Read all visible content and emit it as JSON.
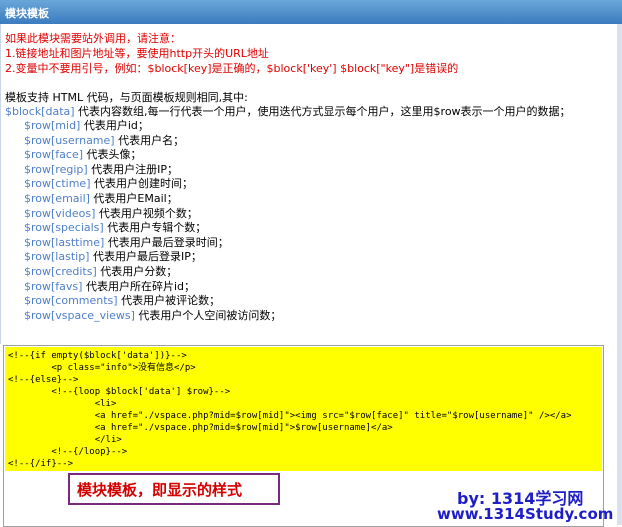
{
  "window": {
    "title": "模块模板"
  },
  "notice": {
    "line1": "如果此模块需要站外调用，请注意：",
    "line2": "1.链接地址和图片地址等，要使用http开头的URL地址",
    "line3": "2.变量中不要用引号，例如：$block[key]是正确的，$block['key'] $block[\"key\"]是错误的"
  },
  "intro": "模板支持 HTML 代码，与页面模板规则相同,其中:",
  "data_var": "$block[data]",
  "data_desc": " 代表内容数组,每一行代表一个用户，使用迭代方式显示每个用户，这里用$row表示一个用户的数据；",
  "fields": [
    {
      "var": "$row[mid]",
      "desc": " 代表用户id；"
    },
    {
      "var": "$row[username]",
      "desc": " 代表用户名；"
    },
    {
      "var": "$row[face]",
      "desc": " 代表头像；"
    },
    {
      "var": "$row[regip]",
      "desc": " 代表用户注册IP；"
    },
    {
      "var": "$row[ctime]",
      "desc": " 代表用户创建时间；"
    },
    {
      "var": "$row[email]",
      "desc": " 代表用户EMail；"
    },
    {
      "var": "$row[videos]",
      "desc": " 代表用户视频个数；"
    },
    {
      "var": "$row[specials]",
      "desc": " 代表用户专辑个数；"
    },
    {
      "var": "$row[lasttime]",
      "desc": " 代表用户最后登录时间；"
    },
    {
      "var": "$row[lastip]",
      "desc": " 代表用户最后登录IP；"
    },
    {
      "var": "$row[credits]",
      "desc": " 代表用户分数；"
    },
    {
      "var": "$row[favs]",
      "desc": " 代表用户所在碎片id；"
    },
    {
      "var": "$row[comments]",
      "desc": " 代表用户被评论数；"
    },
    {
      "var": "$row[vspace_views]",
      "desc": " 代表用户个人空间被访问数；"
    }
  ],
  "code_lines": [
    "<!--{if empty($block['data'])}-->",
    "        <p class=\"info\">没有信息</p>",
    "<!--{else}-->",
    "        <!--{loop $block['data'] $row}-->",
    "                <li>",
    "                <a href=\"./vspace.php?mid=$row[mid]\"><img src=\"$row[face]\" title=\"$row[username]\" /></a>",
    "                <a href=\"./vspace.php?mid=$row[mid]\">$row[username]</a>",
    "                </li>",
    "        <!--{/loop}-->",
    "<!--{/if}-->"
  ],
  "annotation": "模块模板，即显示的样式",
  "watermark": {
    "line1": "by: 1314学习网",
    "line2": "www.1314Study.com"
  },
  "colors": {
    "titlebar": "#3b7bbf",
    "warning": "#e00000",
    "variable": "#4f7fc8",
    "highlight": "#ffff00"
  }
}
